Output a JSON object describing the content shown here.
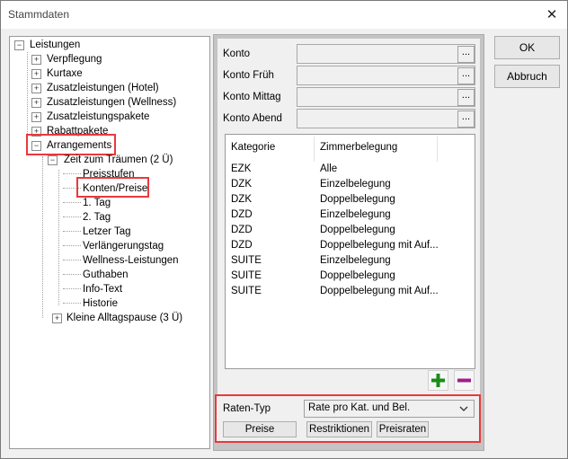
{
  "window": {
    "title": "Stammdaten",
    "close_glyph": "✕"
  },
  "tree": {
    "root": "Leistungen",
    "items": [
      "Verpflegung",
      "Kurtaxe",
      "Zusatzleistungen (Hotel)",
      "Zusatzleistungen (Wellness)",
      "Zusatzleistungspakete",
      "Rabattpakete"
    ],
    "arrangements": "Arrangements",
    "arrangement_1": "Zeit zum Träumen (2 Ü)",
    "arrangement_1_children": [
      "Preisstufen",
      "Konten/Preise",
      "1. Tag",
      "2. Tag",
      "Letzer Tag",
      "Verlängerungstag",
      "Wellness-Leistungen",
      "Guthaben",
      "Info-Text",
      "Historie"
    ],
    "arrangement_2": "Kleine Alltagspause (3 Ü)",
    "glyph_plus": "+",
    "glyph_minus": "−"
  },
  "accounts": {
    "konto": "Konto",
    "konto_frueh": "Konto Früh",
    "konto_mittag": "Konto Mittag",
    "konto_abend": "Konto Abend",
    "ellipsis": "..."
  },
  "list": {
    "columns": [
      "Kategorie",
      "Zimmerbelegung"
    ],
    "rows": [
      [
        "EZK",
        "Alle"
      ],
      [
        "DZK",
        "Einzelbelegung"
      ],
      [
        "DZK",
        "Doppelbelegung"
      ],
      [
        "DZD",
        "Einzelbelegung"
      ],
      [
        "DZD",
        "Doppelbelegung"
      ],
      [
        "DZD",
        "Doppelbelegung mit Auf..."
      ],
      [
        "SUITE",
        "Einzelbelegung"
      ],
      [
        "SUITE",
        "Doppelbelegung"
      ],
      [
        "SUITE",
        "Doppelbelegung mit Auf..."
      ]
    ]
  },
  "icons": {
    "add": "add-icon",
    "remove": "remove-icon",
    "add_color": "#1a8c1a",
    "remove_color": "#9c1f8c"
  },
  "rates": {
    "label": "Raten-Typ",
    "value": "Rate pro Kat. und Bel.",
    "btn_preise": "Preise",
    "btn_restriktionen": "Restriktionen",
    "btn_preisraten": "Preisraten"
  },
  "buttons": {
    "ok": "OK",
    "cancel": "Abbruch"
  },
  "highlight_color": "#e8393c"
}
